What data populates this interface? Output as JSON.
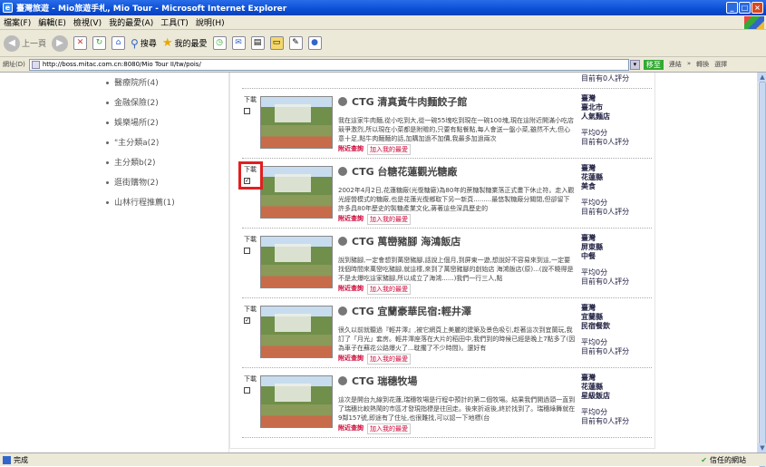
{
  "window": {
    "title": "臺灣旅遊 - Mio旅遊手札, Mio Tour - Microsoft Internet Explorer",
    "controls": [
      "_",
      "□",
      "×"
    ]
  },
  "menu": [
    "檔案(F)",
    "編輯(E)",
    "檢視(V)",
    "我的最愛(A)",
    "工具(T)",
    "說明(H)"
  ],
  "toolbar": {
    "back": "上一頁",
    "search": "搜尋",
    "favorites": "我的最愛"
  },
  "address": {
    "label": "網址(D)",
    "url": "http://boss.mitac.com.cn:8080/Mio Tour II/tw/pois/",
    "go": "移至",
    "links": [
      "連結",
      "»",
      "轉換",
      "選擇"
    ]
  },
  "categories": [
    {
      "label": "醫療院所(4)"
    },
    {
      "label": "金融保險(2)"
    },
    {
      "label": "娛樂場所(2)"
    },
    {
      "label": "\"主分類a(2)"
    },
    {
      "label": "主分類b(2)"
    },
    {
      "label": "逛街購物(2)"
    },
    {
      "label": "山林行程推薦(1)"
    }
  ],
  "items": [
    {
      "download": "下載",
      "checked": false,
      "title": "CTG 清真黃牛肉麵餃子館",
      "desc": "我在這家牛肉麵,從小吃到大,從一碗55塊吃到現在一碗100塊,現在這附近開滿小吃店競爭激烈,所以現在小菜都是附贈的,只要有點餐點,每人會送一盤小菜,雖然不大,但心意十足,點牛肉麵麵的話,加購加過不加價,我最多加過兩次",
      "nearby": "附近查詢",
      "add": "加入我的最愛",
      "region": "臺灣",
      "city": "臺北市",
      "category": "人氣麵店",
      "avg": "平均0分",
      "count": "目前有0人評分"
    },
    {
      "download": "下載",
      "checked": true,
      "title": "CTG 台糖花蓮觀光糖廠",
      "desc": "2002年4月2日,花蓮糖廠(光復糖廠)為80年的蔗糖製糖業落正式畫下休止符。走入觀光經營模式的糖廠,也是花蓮光復鄉取下另一新頁.........最悠製糖廠分關閉,但卻留下許多具80年歷史的製糖產業文化,蔣著這些深具歷史的",
      "nearby": "附近查詢",
      "add": "加入我的最愛",
      "region": "臺灣",
      "city": "花蓮縣",
      "category": "美食",
      "avg": "平均0分",
      "count": "目前有0人評分"
    },
    {
      "download": "下載",
      "checked": false,
      "title": "CTG 萬巒豬腳 海鴻飯店",
      "desc": "說到豬腳,一定會想到萬巒豬腳,話說上個月,到屏東一遊,想說好不容易來到這,一定要找個時間來萬巒吃豬腳,就這樣,來到了萬巒豬腳的創始店 海鴻飯店(原)...(說不曉得是不是太爆吃這家豬腳,所以成立了海鴻......)我們一行三人,點",
      "nearby": "附近查詢",
      "add": "加入我的最愛",
      "region": "臺灣",
      "city": "屏東縣",
      "category": "中餐",
      "avg": "平均0分",
      "count": "目前有0人評分"
    },
    {
      "download": "下載",
      "checked": true,
      "title": "CTG 宜蘭豪華民宿:輕井澤",
      "desc": "很久以前就聽過『輕井澤』,被它網頁上美麗的建築及景色吸引,趁著這次到宜蘭玩,我訂了「月光」套房。輕井澤座落在大片的稻田中,我們到的時候已經是晚上7點多了(因為車子在蘇花公路爆火了...耽擱了不少時間)。還好有",
      "nearby": "附近查詢",
      "add": "加入我的最愛",
      "region": "臺灣",
      "city": "宜蘭縣",
      "category": "民宿餐飲",
      "avg": "平均0分",
      "count": "目前有0人評分"
    },
    {
      "download": "下載",
      "checked": false,
      "title": "CTG 瑞穗牧場",
      "desc": "這次是開台九線到花蓮,瑞穗牧場是行程中預計的第二個牧場。結果我們開過頭一直到了瑞穗比較熱鬧的市區才發現指標是往回走。後來折返後,終於找到了。瑞穗綠舞就在9鄰157號,即途有了住址,也很難找,可以認一下地標(台",
      "nearby": "附近查詢",
      "add": "加入我的最愛",
      "region": "臺灣",
      "city": "花蓮縣",
      "category": "星級飯店",
      "avg": "平均0分",
      "count": "目前有0人評分"
    }
  ],
  "top_partial": {
    "count": "目前有0人評分"
  },
  "status": {
    "left": "完成",
    "zone": "信任的網站"
  }
}
